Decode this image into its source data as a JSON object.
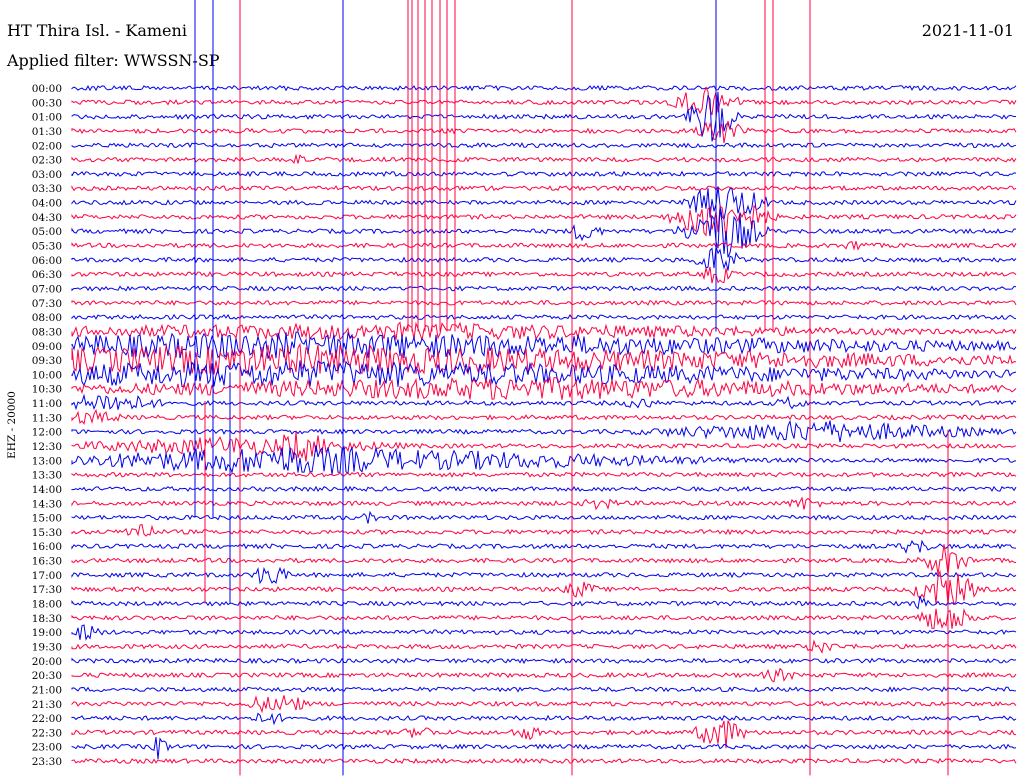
{
  "header": {
    "station": "HT Thira Isl. - Kameni",
    "filter": "Applied filter: WWSSN-SP",
    "date": "2021-11-01"
  },
  "channel_label": "EHZ - 20000",
  "colors": {
    "trace_a": "#0000ee",
    "trace_b": "#ff0040",
    "text": "#000000",
    "background": "#ffffff"
  },
  "time_labels": [
    "00:00",
    "00:30",
    "01:00",
    "01:30",
    "02:00",
    "02:30",
    "03:00",
    "03:30",
    "04:00",
    "04:30",
    "05:00",
    "05:30",
    "06:00",
    "06:30",
    "07:00",
    "07:30",
    "08:00",
    "08:30",
    "09:00",
    "09:30",
    "10:00",
    "10:30",
    "11:00",
    "11:30",
    "12:00",
    "12:30",
    "13:00",
    "13:30",
    "14:00",
    "14:30",
    "15:00",
    "15:30",
    "16:00",
    "16:30",
    "17:00",
    "17:30",
    "18:00",
    "18:30",
    "19:00",
    "19:30",
    "20:00",
    "20:30",
    "21:00",
    "21:30",
    "22:00",
    "22:30",
    "23:00",
    "23:30"
  ]
}
